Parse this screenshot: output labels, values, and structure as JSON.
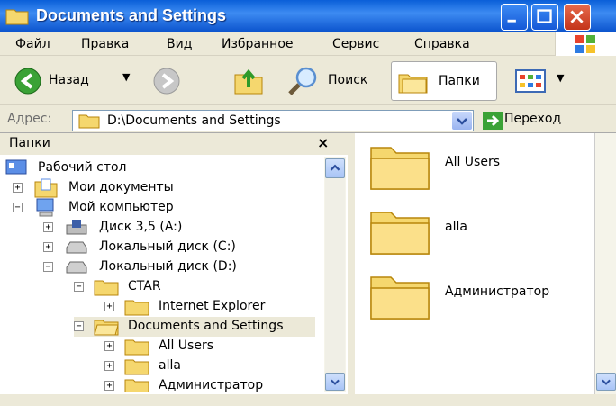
{
  "window": {
    "title": "Documents and Settings"
  },
  "menu": [
    "Файл",
    "Правка",
    "Вид",
    "Избранное",
    "Сервис",
    "Справка"
  ],
  "toolbar": {
    "back": "Назад",
    "search": "Поиск",
    "folders": "Папки"
  },
  "address": {
    "label": "Адрес:",
    "value": "D:\\Documents and Settings",
    "go": "Переход"
  },
  "folders_pane": {
    "title": "Папки",
    "close": "×"
  },
  "tree": [
    {
      "label": "Рабочий стол"
    },
    {
      "label": "Мои документы"
    },
    {
      "label": "Мой компьютер"
    },
    {
      "label": "Диск 3,5 (A:)"
    },
    {
      "label": "Локальный диск (C:)"
    },
    {
      "label": "Локальный диск (D:)"
    },
    {
      "label": "CTAR"
    },
    {
      "label": "Internet Explorer"
    },
    {
      "label": "Documents and Settings"
    },
    {
      "label": "All Users"
    },
    {
      "label": "alla"
    },
    {
      "label": "Администратор"
    }
  ],
  "files": [
    {
      "label": "All Users"
    },
    {
      "label": "alla"
    },
    {
      "label": "Администратор"
    }
  ],
  "colors": {
    "titlebar": "#0a5fd8",
    "chrome": "#ece9d8",
    "folder": "#f5d76e"
  }
}
